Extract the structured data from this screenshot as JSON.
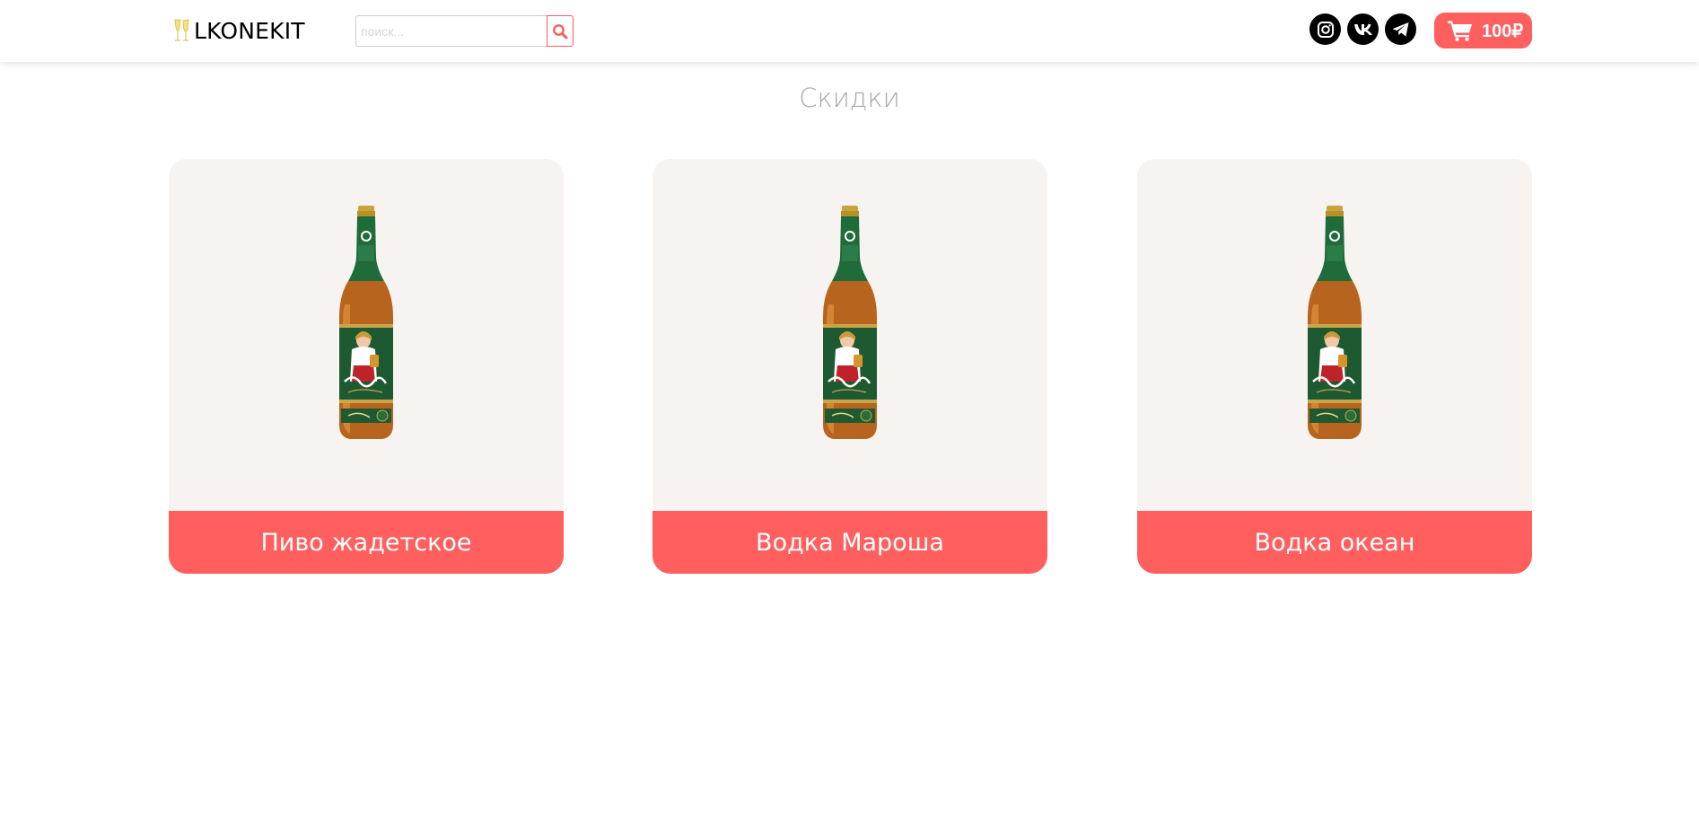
{
  "header": {
    "logo_text": "LKONEKIT",
    "search": {
      "placeholder": "поиск...",
      "value": ""
    },
    "socials": [
      {
        "name": "instagram",
        "icon": "instagram-icon"
      },
      {
        "name": "vk",
        "icon": "vk-icon"
      },
      {
        "name": "telegram",
        "icon": "telegram-icon"
      }
    ],
    "cart": {
      "icon": "cart-icon",
      "total": "100₽"
    }
  },
  "main": {
    "section_title": "Скидки",
    "products": [
      {
        "name": "Пиво жадетское",
        "image": "beer-bottle"
      },
      {
        "name": "Водка Мароша",
        "image": "beer-bottle"
      },
      {
        "name": "Водка океан",
        "image": "beer-bottle"
      }
    ]
  },
  "colors": {
    "accent": "#ff5f5f",
    "card_bg": "#f6f3f1",
    "title_gray": "#a9a9a9"
  }
}
